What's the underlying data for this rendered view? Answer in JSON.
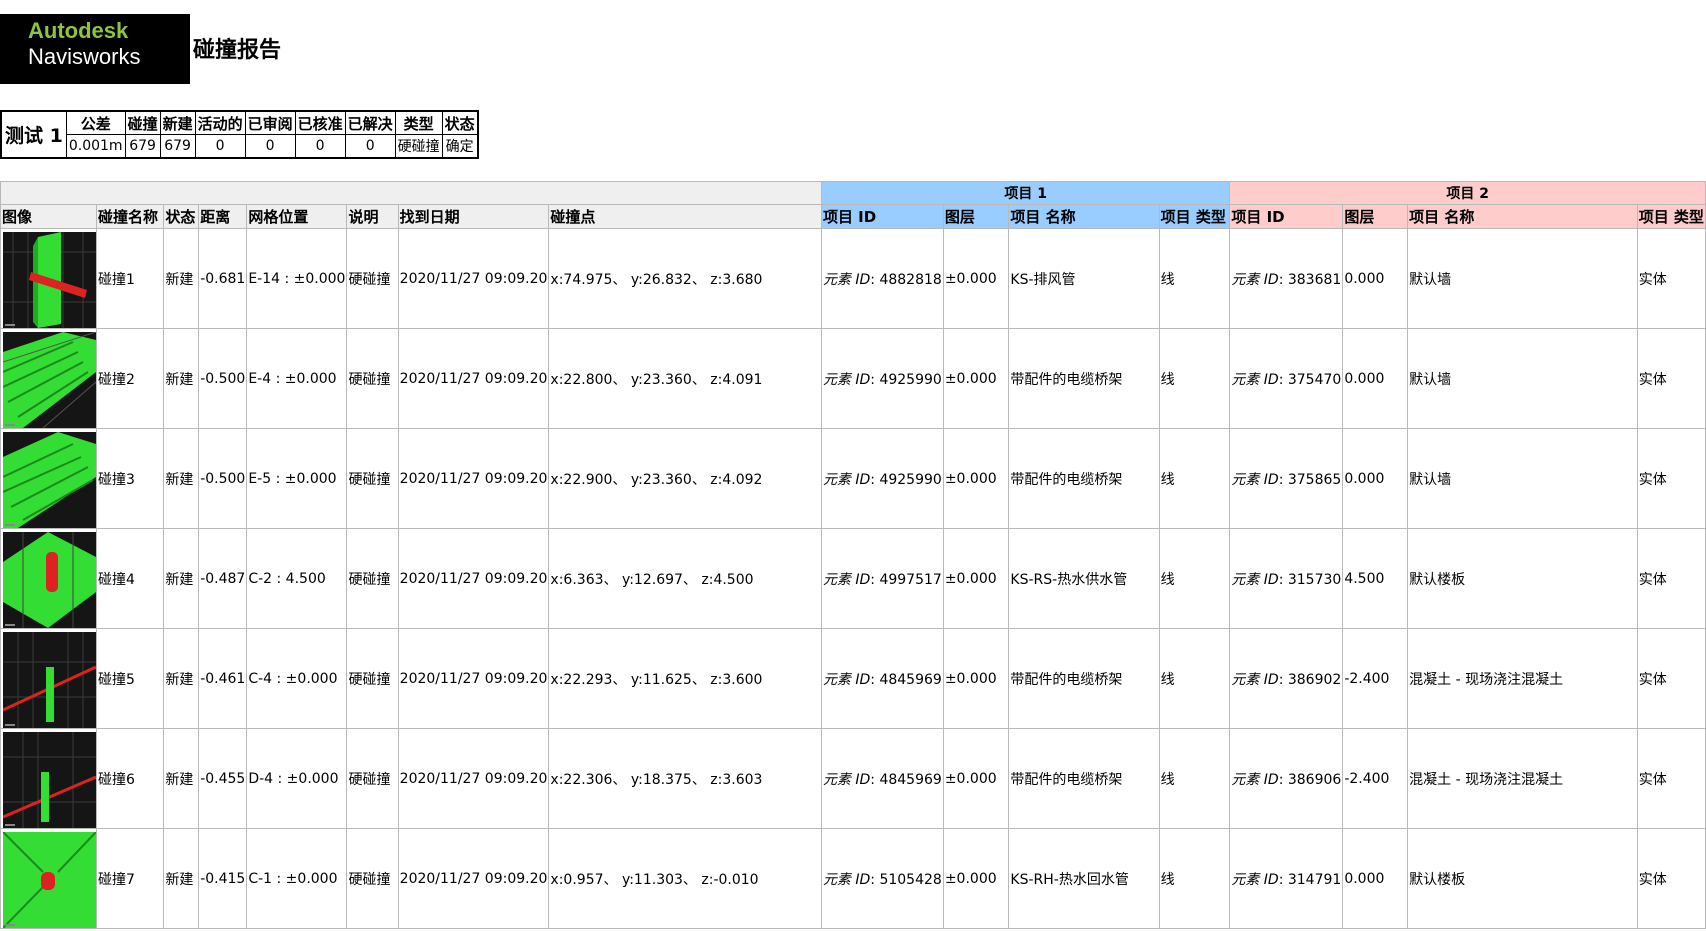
{
  "logo": {
    "brand": "Autodesk",
    "product": "Navisworks"
  },
  "report_title": "碰撞报告",
  "summary": {
    "test_name": "测试 1",
    "headers": [
      "公差",
      "碰撞",
      "新建",
      "活动的",
      "已审阅",
      "已核准",
      "已解决",
      "类型",
      "状态"
    ],
    "values": [
      "0.001m",
      "679",
      "679",
      "0",
      "0",
      "0",
      "0",
      "硬碰撞",
      "确定"
    ]
  },
  "clash_table": {
    "group_item1": "项目 1",
    "group_item2": "项目 2",
    "headers": [
      "图像",
      "碰撞名称",
      "状态",
      "距离",
      "网格位置",
      "说明",
      "找到日期",
      "碰撞点",
      "项目 ID",
      "图层",
      "项目 名称",
      "项目 类型",
      "项目 ID",
      "图层",
      "项目 名称",
      "项目 类型"
    ],
    "element_id_label": "元素 ID",
    "rows": [
      {
        "name": "碰撞1",
        "status": "新建",
        "distance": "-0.681",
        "grid": "E-14 : ±0.000",
        "desc": "硬碰撞",
        "date": "2020/11/27  09:09.20",
        "point": "x:74.975、 y:26.832、 z:3.680",
        "i1_id": ": 4882818",
        "i1_layer": "±0.000",
        "i1_name": "KS-排风管",
        "i1_type": "线",
        "i2_id": ": 383681",
        "i2_layer": "0.000",
        "i2_name": "默认墙",
        "i2_type": "实体"
      },
      {
        "name": "碰撞2",
        "status": "新建",
        "distance": "-0.500",
        "grid": "E-4 : ±0.000",
        "desc": "硬碰撞",
        "date": "2020/11/27  09:09.20",
        "point": "x:22.800、 y:23.360、 z:4.091",
        "i1_id": ": 4925990",
        "i1_layer": "±0.000",
        "i1_name": "带配件的电缆桥架",
        "i1_type": "线",
        "i2_id": ": 375470",
        "i2_layer": "0.000",
        "i2_name": "默认墙",
        "i2_type": "实体"
      },
      {
        "name": "碰撞3",
        "status": "新建",
        "distance": "-0.500",
        "grid": "E-5 : ±0.000",
        "desc": "硬碰撞",
        "date": "2020/11/27  09:09.20",
        "point": "x:22.900、 y:23.360、 z:4.092",
        "i1_id": ": 4925990",
        "i1_layer": "±0.000",
        "i1_name": "带配件的电缆桥架",
        "i1_type": "线",
        "i2_id": ": 375865",
        "i2_layer": "0.000",
        "i2_name": "默认墙",
        "i2_type": "实体"
      },
      {
        "name": "碰撞4",
        "status": "新建",
        "distance": "-0.487",
        "grid": "C-2 : 4.500",
        "desc": "硬碰撞",
        "date": "2020/11/27  09:09.20",
        "point": "x:6.363、 y:12.697、 z:4.500",
        "i1_id": ": 4997517",
        "i1_layer": "±0.000",
        "i1_name": "KS-RS-热水供水管",
        "i1_type": "线",
        "i2_id": ": 315730",
        "i2_layer": "4.500",
        "i2_name": "默认楼板",
        "i2_type": "实体"
      },
      {
        "name": "碰撞5",
        "status": "新建",
        "distance": "-0.461",
        "grid": "C-4 : ±0.000",
        "desc": "硬碰撞",
        "date": "2020/11/27  09:09.20",
        "point": "x:22.293、 y:11.625、 z:3.600",
        "i1_id": ": 4845969",
        "i1_layer": "±0.000",
        "i1_name": "带配件的电缆桥架",
        "i1_type": "线",
        "i2_id": ": 386902",
        "i2_layer": "-2.400",
        "i2_name": "混凝土 - 现场浇注混凝土",
        "i2_type": "实体"
      },
      {
        "name": "碰撞6",
        "status": "新建",
        "distance": "-0.455",
        "grid": "D-4 : ±0.000",
        "desc": "硬碰撞",
        "date": "2020/11/27  09:09.20",
        "point": "x:22.306、 y:18.375、 z:3.603",
        "i1_id": ": 4845969",
        "i1_layer": "±0.000",
        "i1_name": "带配件的电缆桥架",
        "i1_type": "线",
        "i2_id": ": 386906",
        "i2_layer": "-2.400",
        "i2_name": "混凝土 - 现场浇注混凝土",
        "i2_type": "实体"
      },
      {
        "name": "碰撞7",
        "status": "新建",
        "distance": "-0.415",
        "grid": "C-1 : ±0.000",
        "desc": "硬碰撞",
        "date": "2020/11/27  09:09.20",
        "point": "x:0.957、 y:11.303、 z:-0.010",
        "i1_id": ": 5105428",
        "i1_layer": "±0.000",
        "i1_name": "KS-RH-热水回水管",
        "i1_type": "线",
        "i2_id": ": 314791",
        "i2_layer": "0.000",
        "i2_name": "默认楼板",
        "i2_type": "实体"
      }
    ]
  },
  "colors": {
    "item1_header": "#99ccff",
    "item2_header": "#ffcccc",
    "clash_green": "#33dd33",
    "clash_red": "#dd2222",
    "logo_green": "#8cc63f"
  }
}
